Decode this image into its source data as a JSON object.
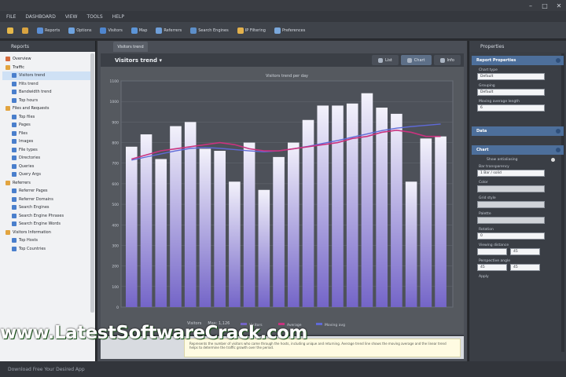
{
  "window": {
    "title": "",
    "buttons": [
      "–",
      "□",
      "✕"
    ]
  },
  "menu": [
    "FILE",
    "DASHBOARD",
    "VIEW",
    "TOOLS",
    "HELP"
  ],
  "toolbar": [
    {
      "label": "",
      "color": "#e6b84a"
    },
    {
      "label": "",
      "color": "#d9a441"
    },
    {
      "label": "Reports",
      "color": "#5b8fd6"
    },
    {
      "label": "Options",
      "color": "#6ea3e0"
    },
    {
      "label": "Visitors",
      "color": "#4f86cf"
    },
    {
      "label": "Map",
      "color": "#5c95d8"
    },
    {
      "label": "Referrers",
      "color": "#6f9fd9"
    },
    {
      "label": "Search Engines",
      "color": "#5d8fc9"
    },
    {
      "label": "IP Filtering",
      "color": "#e3b14c"
    },
    {
      "label": "Preferences",
      "color": "#7aa7db"
    }
  ],
  "left_panel": {
    "title": "Reports",
    "tree": [
      {
        "label": "Overview",
        "level": 0,
        "group": true,
        "color": "#d46a3c"
      },
      {
        "label": "Traffic",
        "level": 0,
        "group": true,
        "color": "#e2a43f"
      },
      {
        "label": "Visitors trend",
        "level": 1,
        "selected": true,
        "color": "#4a7fcc"
      },
      {
        "label": "Hits trend",
        "level": 1,
        "color": "#4a7fcc"
      },
      {
        "label": "Bandwidth trend",
        "level": 1,
        "color": "#4a7fcc"
      },
      {
        "label": "Top hours",
        "level": 1,
        "color": "#4a7fcc"
      },
      {
        "label": "Files and Requests",
        "level": 0,
        "group": true,
        "color": "#e2a43f"
      },
      {
        "label": "Top files",
        "level": 1,
        "color": "#4a7fcc"
      },
      {
        "label": "Pages",
        "level": 1,
        "color": "#4a7fcc"
      },
      {
        "label": "Files",
        "level": 1,
        "color": "#4a7fcc"
      },
      {
        "label": "Images",
        "level": 1,
        "color": "#4a7fcc"
      },
      {
        "label": "File types",
        "level": 1,
        "color": "#4a7fcc"
      },
      {
        "label": "Directories",
        "level": 1,
        "color": "#4a7fcc"
      },
      {
        "label": "Queries",
        "level": 1,
        "color": "#4a7fcc"
      },
      {
        "label": "Query Args",
        "level": 1,
        "color": "#4a7fcc"
      },
      {
        "label": "Referrers",
        "level": 0,
        "group": true,
        "color": "#e2a43f"
      },
      {
        "label": "Referrer Pages",
        "level": 1,
        "color": "#4a7fcc"
      },
      {
        "label": "Referrer Domains",
        "level": 1,
        "color": "#4a7fcc"
      },
      {
        "label": "Search Engines",
        "level": 1,
        "color": "#4a7fcc"
      },
      {
        "label": "Search Engine Phrases",
        "level": 1,
        "color": "#4a7fcc"
      },
      {
        "label": "Search Engine Words",
        "level": 1,
        "color": "#4a7fcc"
      },
      {
        "label": "Visitors Information",
        "level": 0,
        "group": true,
        "color": "#e2a43f"
      },
      {
        "label": "Top Hosts",
        "level": 1,
        "color": "#4a7fcc"
      },
      {
        "label": "Top Countries",
        "level": 1,
        "color": "#4a7fcc"
      }
    ]
  },
  "center": {
    "doc_tab": "Visitors trend",
    "header_title": "Visitors trend ▾",
    "view_buttons": [
      {
        "label": "List",
        "active": false
      },
      {
        "label": "Chart",
        "active": true
      },
      {
        "label": "Info",
        "active": false
      }
    ],
    "bottom_strip": [
      "Visitors",
      "Max: 1,126"
    ],
    "info_text": "Represents the number of visitors who came through the hosts, including unique and returning. Average trend line shows the moving average and the linear trend helps to determine the traffic growth over the period."
  },
  "chart_data": {
    "type": "bar",
    "title": "Visitors trend per day",
    "values": [
      780,
      840,
      720,
      880,
      900,
      770,
      760,
      610,
      800,
      570,
      730,
      800,
      910,
      980,
      980,
      990,
      1040,
      970,
      940,
      610,
      820,
      830
    ],
    "avg_series": [
      720,
      740,
      760,
      770,
      780,
      790,
      800,
      790,
      770,
      760,
      760,
      770,
      780,
      790,
      800,
      820,
      830,
      850,
      860,
      850,
      830,
      830
    ],
    "trend_series": [
      715,
      730,
      745,
      760,
      772,
      776,
      772,
      766,
      760,
      755,
      760,
      770,
      782,
      796,
      810,
      826,
      842,
      858,
      870,
      878,
      884,
      890
    ],
    "ylim": [
      0,
      1100
    ],
    "yticks": [
      0,
      100,
      200,
      300,
      400,
      500,
      600,
      700,
      800,
      900,
      1000,
      1100
    ],
    "grid": true,
    "legend": [
      "Visitors",
      "Average",
      "Moving avg"
    ],
    "colors": {
      "bar_top": "#f3f2fb",
      "bar_bottom": "#7465c8",
      "avg": "#c9337f",
      "trend": "#5f6ad8"
    }
  },
  "right_panel": {
    "title": "Properties",
    "sections": {
      "s1": "Report Properties",
      "s2": "Data",
      "s3": "Chart"
    },
    "rows1": [
      {
        "label": "Chart type",
        "value": "Default"
      },
      {
        "label": "Grouping",
        "value": "Default"
      },
      {
        "label": "Moving average length",
        "value": "6"
      }
    ],
    "chart_rows": [
      {
        "label": "Show antialiasing",
        "check": true
      },
      {
        "label": "Bar transparency",
        "value": "1 Bar / solid"
      },
      {
        "label": "Color",
        "value": ""
      },
      {
        "label": "Grid style",
        "value": ""
      },
      {
        "label": "Palette",
        "value": ""
      },
      {
        "label": "Rotation",
        "value": "0"
      }
    ],
    "pair_rows": [
      {
        "label": "Viewing distance",
        "values": [
          "",
          "45"
        ]
      },
      {
        "label": "Perspective angle",
        "values": [
          "45",
          "45"
        ]
      }
    ],
    "last_label": "Apply"
  },
  "watermark": "www.LatestSoftwareCrack.com",
  "status": "Download Free Your Desired App"
}
